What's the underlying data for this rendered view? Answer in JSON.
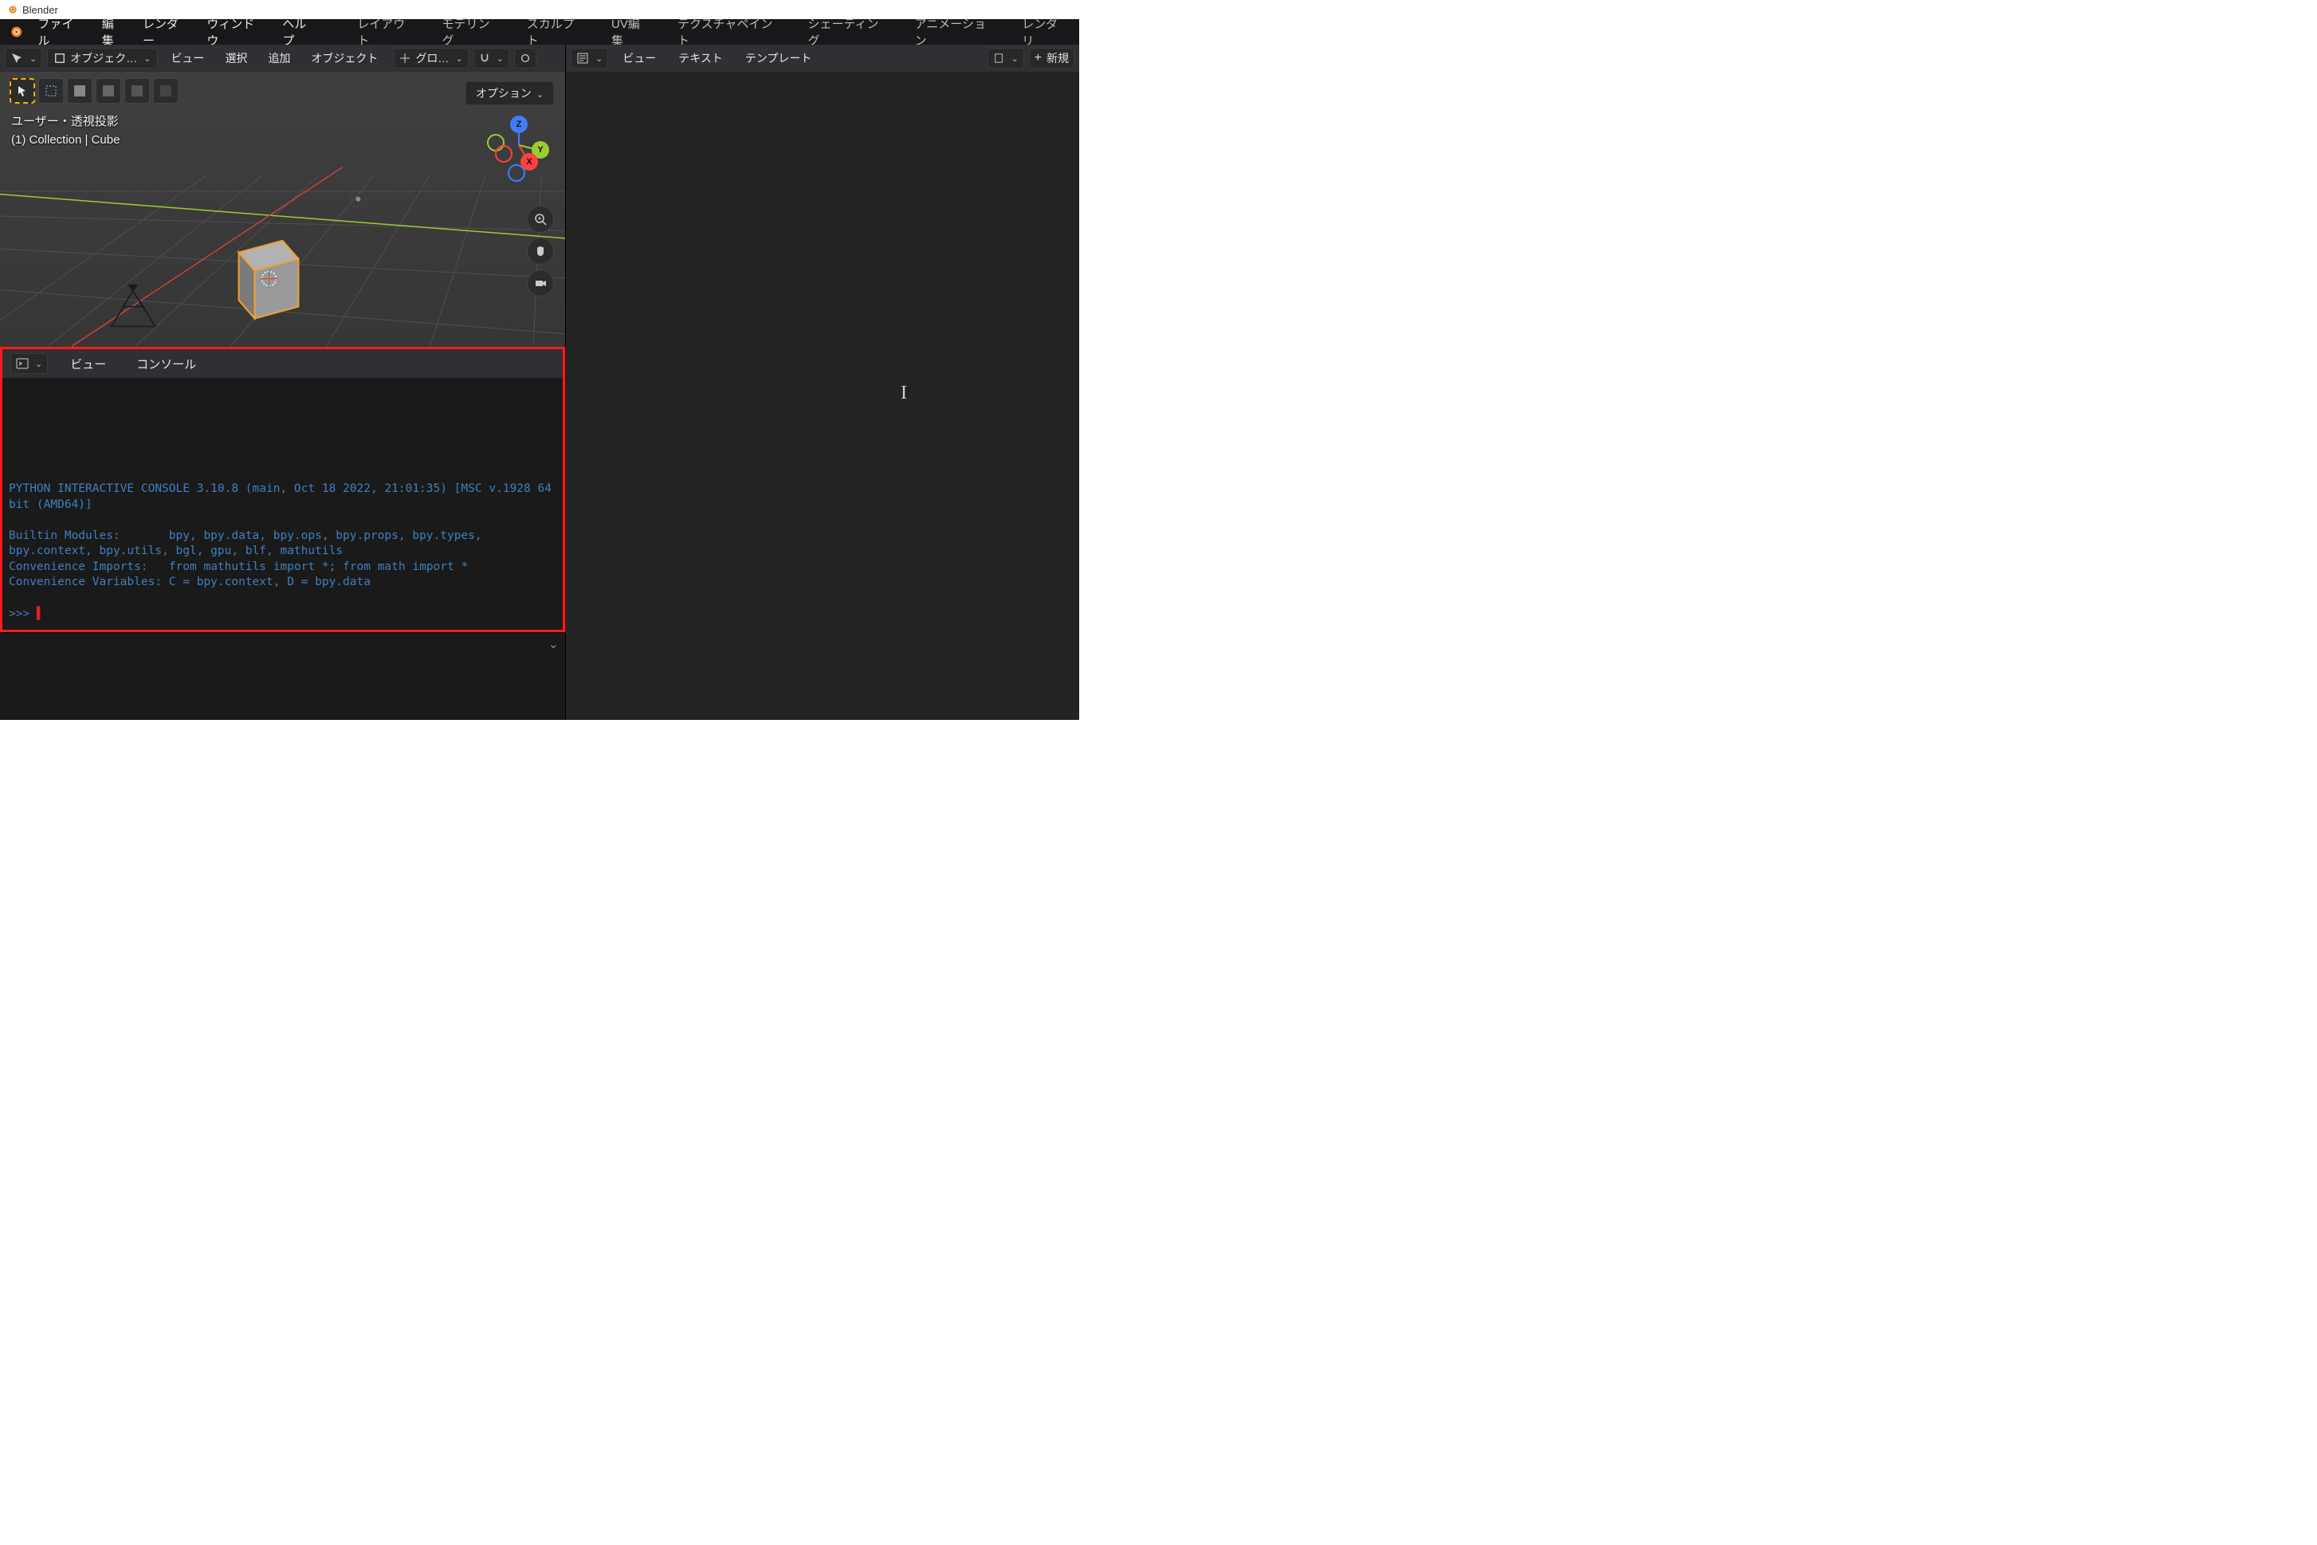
{
  "app": {
    "title": "Blender"
  },
  "menubar": {
    "file": "ファイル",
    "edit": "編集",
    "render": "レンダー",
    "window": "ウィンドウ",
    "help": "ヘルプ"
  },
  "workspaces": [
    "レイアウト",
    "モデリング",
    "スカルプト",
    "UV編集",
    "テクスチャペイント",
    "シェーディング",
    "アニメーション",
    "レンダリ"
  ],
  "viewport_header": {
    "mode_label": "オブジェク…",
    "view": "ビュー",
    "select": "選択",
    "add": "追加",
    "object": "オブジェクト",
    "orientation": "グロ…",
    "options_label": "オプション"
  },
  "viewport_overlay": {
    "line1": "ユーザー・透視投影",
    "line2": "(1) Collection | Cube"
  },
  "axes": {
    "x": "X",
    "y": "Y",
    "z": "Z"
  },
  "console_header": {
    "view": "ビュー",
    "console": "コンソール"
  },
  "console": {
    "line1": "PYTHON INTERACTIVE CONSOLE 3.10.8 (main, Oct 18 2022, 21:01:35) [MSC v.1928 64 bit (AMD64)]",
    "modules_label": "Builtin Modules:",
    "modules": "bpy, bpy.data, bpy.ops, bpy.props, bpy.types, bpy.context, bpy.utils, bgl, gpu, blf, mathutils",
    "imports_label": "Convenience Imports:",
    "imports": "from mathutils import *; from math import *",
    "vars_label": "Convenience Variables:",
    "vars": "C = bpy.context, D = bpy.data",
    "prompt": ">>> "
  },
  "text_editor_header": {
    "view": "ビュー",
    "text": "テキスト",
    "templates": "テンプレート",
    "new": "新規"
  }
}
